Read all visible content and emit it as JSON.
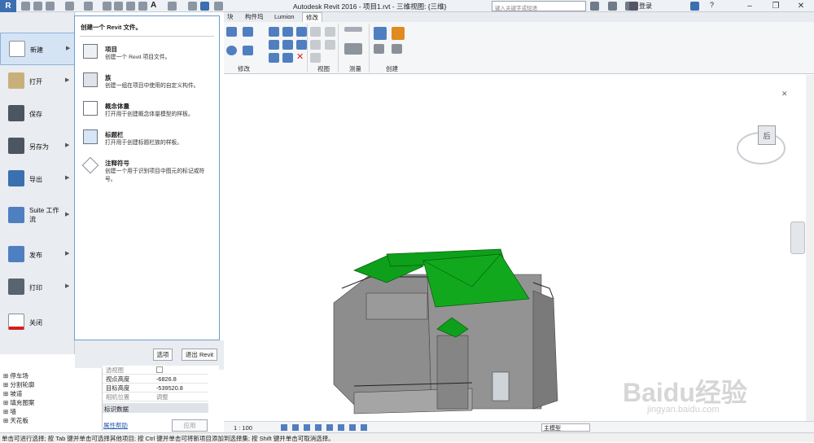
{
  "window": {
    "title": "Autodesk Revit 2016 -    项目1.rvt - 三维视图: {三维}"
  },
  "search": {
    "placeholder": "键入关键字或短语"
  },
  "user": {
    "login": "登录"
  },
  "ribbon": {
    "tabs": [
      {
        "label": "块"
      },
      {
        "label": "构件坞"
      },
      {
        "label": "Lumion"
      },
      {
        "label": "修改"
      }
    ],
    "active_tab": "修改",
    "panels": [
      {
        "label": "修改"
      },
      {
        "label": "视图"
      },
      {
        "label": "测量"
      },
      {
        "label": "创建"
      }
    ]
  },
  "app_menu": {
    "items": [
      {
        "label": "新建",
        "icon": "new-doc-icon",
        "active": true,
        "has_arrow": true
      },
      {
        "label": "打开",
        "icon": "open-folder-icon",
        "has_arrow": true
      },
      {
        "label": "保存",
        "icon": "save-disk-icon",
        "has_arrow": false
      },
      {
        "label": "另存为",
        "icon": "save-as-icon",
        "has_arrow": true
      },
      {
        "label": "导出",
        "icon": "export-icon",
        "has_arrow": true
      },
      {
        "label": "Suite 工作流",
        "icon": "suite-workflow-icon",
        "has_arrow": true
      },
      {
        "label": "发布",
        "icon": "publish-icon",
        "has_arrow": true
      },
      {
        "label": "打印",
        "icon": "print-icon",
        "has_arrow": true
      },
      {
        "label": "关闭",
        "icon": "close-doc-icon",
        "has_arrow": false
      }
    ],
    "flyout": {
      "title": "创建一个 Revit 文件。",
      "entries": [
        {
          "name": "项目",
          "desc": "创建一个 Revit 项目文件。",
          "icon": "project-icon"
        },
        {
          "name": "族",
          "desc": "创建一组在项目中使用的自定义构件。",
          "icon": "family-icon"
        },
        {
          "name": "概念体量",
          "desc": "打开用于创建概念体量模型的样板。",
          "icon": "mass-icon"
        },
        {
          "name": "标题栏",
          "desc": "打开用于创建标题栏族的样板。",
          "icon": "titleblock-icon"
        },
        {
          "name": "注释符号",
          "desc": "创建一个用于识别项目中图元的标记或符号。",
          "icon": "annotation-icon"
        }
      ]
    },
    "options_button": "选项",
    "exit_button": "退出 Revit"
  },
  "project_browser": {
    "rows": [
      "停车场",
      "分割轮廓",
      "坡道",
      "填充图案",
      "墙",
      "天花板"
    ]
  },
  "properties": {
    "rows": [
      {
        "label": "透视图",
        "value": ""
      },
      {
        "label": "视点高度",
        "value": "-6826.8"
      },
      {
        "label": "目标高度",
        "value": "-539520.8"
      },
      {
        "label": "相机位置",
        "value": "调整"
      }
    ],
    "group": "标识数据",
    "help_link": "属性帮助",
    "apply_button": "应用"
  },
  "view_bar": {
    "scale": "1 : 100",
    "model": "主模型"
  },
  "status": {
    "text": "单击可进行选择; 按 Tab 键并单击可选择其他项目; 按 Ctrl 键并单击可将新项目添加到选择集; 按 Shift 键并单击可取消选择。"
  },
  "viewcube": {
    "face": "后"
  },
  "watermark": {
    "text": "Baidu经验",
    "sub": "jingyan.baidu.com"
  },
  "colors": {
    "roof": "#0ea01a",
    "wall": "#8c8c8c",
    "accent": "#3b6fb0"
  }
}
